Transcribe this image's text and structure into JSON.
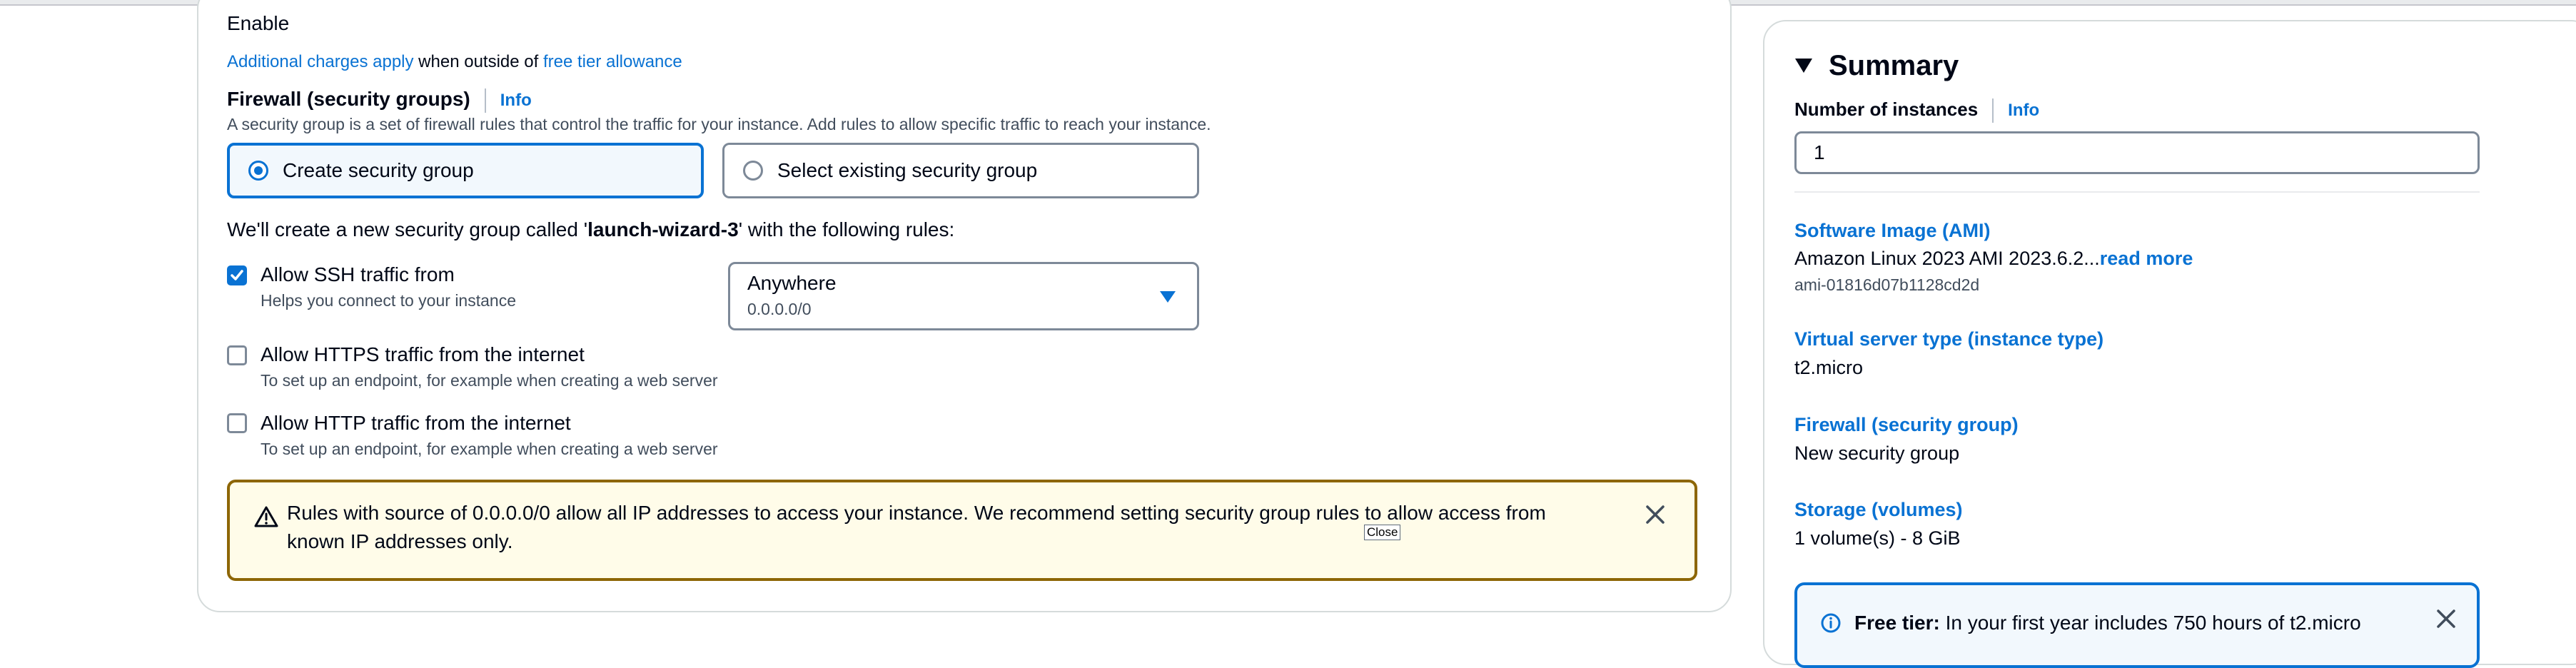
{
  "storage": {
    "enable_label": "Enable",
    "charges_link": "Additional charges apply",
    "charges_middle": " when outside of ",
    "free_tier_link": "free tier allowance"
  },
  "firewall": {
    "heading": "Firewall (security groups)",
    "info": "Info",
    "description": "A security group is a set of firewall rules that control the traffic for your instance. Add rules to allow specific traffic to reach your instance.",
    "option_create": "Create security group",
    "option_select": "Select existing security group",
    "new_group_prefix": "We'll create a new security group called '",
    "new_group_name": "launch-wizard-3",
    "new_group_suffix": "' with the following rules:",
    "rules": [
      {
        "label": "Allow SSH traffic from",
        "description": "Helps you connect to your instance",
        "checked": true
      },
      {
        "label": "Allow HTTPS traffic from the internet",
        "description": "To set up an endpoint, for example when creating a web server",
        "checked": false
      },
      {
        "label": "Allow HTTP traffic from the internet",
        "description": "To set up an endpoint, for example when creating a web server",
        "checked": false
      }
    ],
    "ssh_source": {
      "value": "Anywhere",
      "detail": "0.0.0.0/0"
    },
    "warning_line1": "Rules with source of 0.0.0.0/0 allow all IP addresses to access your instance. We recommend setting security group rules to allow access from",
    "warning_line2": "known IP addresses only.",
    "close_tooltip": "Close"
  },
  "summary": {
    "title": "Summary",
    "instances_label": "Number of instances",
    "info": "Info",
    "instances_value": "1",
    "ami_label": "Software Image (AMI)",
    "ami_value": "Amazon Linux 2023 AMI 2023.6.2...",
    "ami_read_more": "read more",
    "ami_id": "ami-01816d07b1128cd2d",
    "instance_type_label": "Virtual server type (instance type)",
    "instance_type_value": "t2.micro",
    "firewall_label": "Firewall (security group)",
    "firewall_value": "New security group",
    "storage_label": "Storage (volumes)",
    "storage_value": "1 volume(s) - 8 GiB",
    "free_tier_bold": "Free tier:",
    "free_tier_text": " In your first year includes 750 hours of t2.micro"
  },
  "colors": {
    "link": "#0972d3",
    "warning_border": "#8d6605",
    "warning_bg": "#fffce9"
  }
}
